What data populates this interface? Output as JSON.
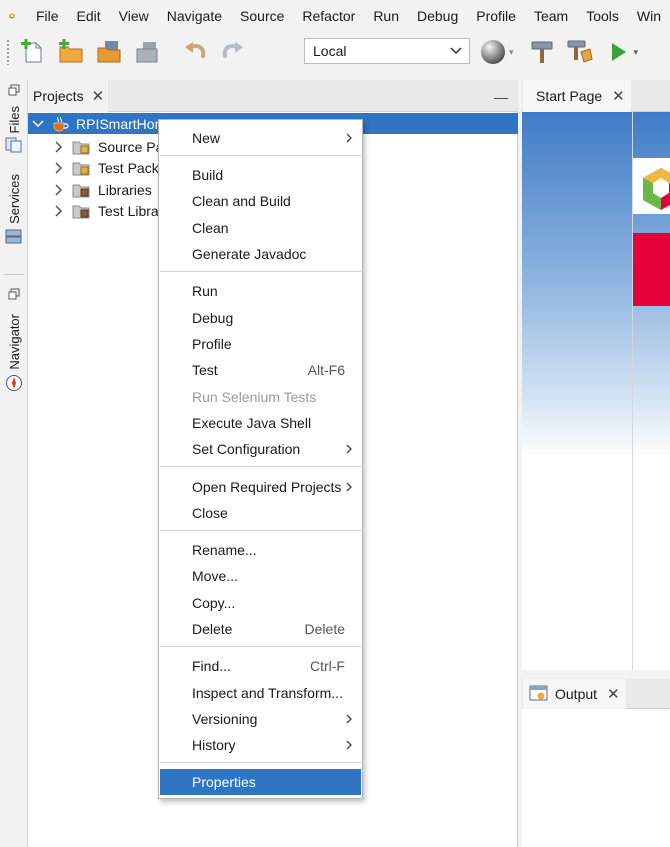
{
  "menubar": {
    "items": [
      "File",
      "Edit",
      "View",
      "Navigate",
      "Source",
      "Refactor",
      "Run",
      "Debug",
      "Profile",
      "Team",
      "Tools",
      "Win"
    ]
  },
  "toolbar": {
    "config_value": "Local",
    "buttons": [
      "new-file-icon",
      "new-project-icon",
      "open-project-icon",
      "close-project-icon",
      "undo-icon",
      "redo-icon",
      "globe-icon",
      "build-hammer-icon",
      "clean-build-icon",
      "run-play-icon"
    ]
  },
  "left_strip": {
    "files_label": "Files",
    "services_label": "Services",
    "navigator_label": "Navigator"
  },
  "projects_panel": {
    "tab_label": "Projects",
    "tree": [
      {
        "label": "RPISmartHor",
        "selected": true
      },
      {
        "label": "Source Pa"
      },
      {
        "label": "Test Pack"
      },
      {
        "label": "Libraries"
      },
      {
        "label": "Test Libra"
      }
    ]
  },
  "start_page": {
    "tab_label": "Start Page"
  },
  "output": {
    "tab_label": "Output"
  },
  "context_menu": {
    "items": [
      {
        "label": "New",
        "submenu": true
      },
      {
        "label": "Build"
      },
      {
        "label": "Clean and Build"
      },
      {
        "label": "Clean"
      },
      {
        "label": "Generate Javadoc"
      },
      {
        "label": "Run"
      },
      {
        "label": "Debug"
      },
      {
        "label": "Profile"
      },
      {
        "label": "Test",
        "shortcut": "Alt-F6"
      },
      {
        "label": "Run Selenium Tests",
        "disabled": true
      },
      {
        "label": "Execute Java Shell"
      },
      {
        "label": "Set Configuration",
        "submenu": true
      },
      {
        "label": "Open Required Projects",
        "submenu": true
      },
      {
        "label": "Close"
      },
      {
        "label": "Rename..."
      },
      {
        "label": "Move..."
      },
      {
        "label": "Copy..."
      },
      {
        "label": "Delete",
        "shortcut": "Delete"
      },
      {
        "label": "Find...",
        "shortcut": "Ctrl-F"
      },
      {
        "label": "Inspect and Transform..."
      },
      {
        "label": "Versioning",
        "submenu": true
      },
      {
        "label": "History",
        "submenu": true
      },
      {
        "label": "Properties",
        "selected": true
      }
    ]
  },
  "colors": {
    "selection": "#2f75c4",
    "accent_red": "#e4003a",
    "run_green": "#3aa03a"
  }
}
